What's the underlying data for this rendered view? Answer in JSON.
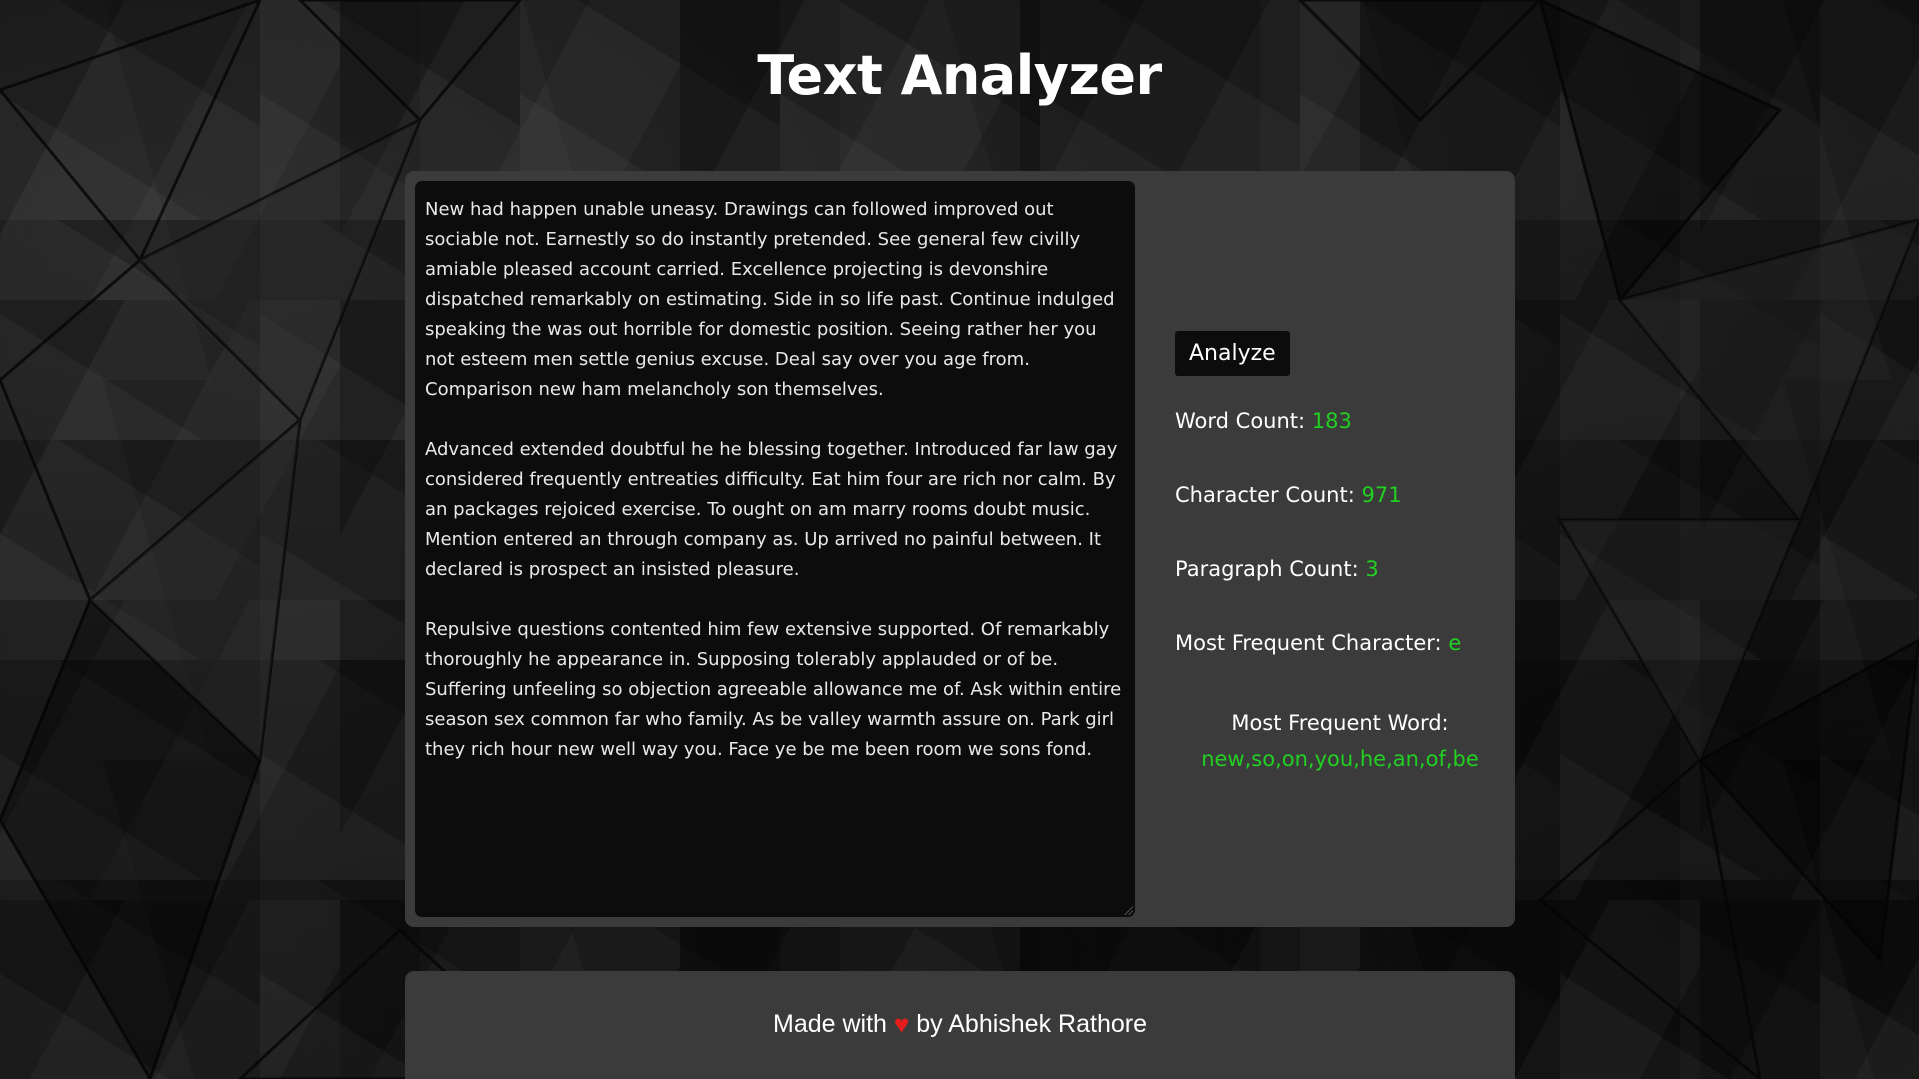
{
  "page": {
    "title": "Text Analyzer"
  },
  "editor": {
    "text": "New had happen unable uneasy. Drawings can followed improved out sociable not. Earnestly so do instantly pretended. See general few civilly amiable pleased account carried. Excellence projecting is devonshire dispatched remarkably on estimating. Side in so life past. Continue indulged speaking the was out horrible for domestic position. Seeing rather her you not esteem men settle genius excuse. Deal say over you age from. Comparison new ham melancholy son themselves.\n\nAdvanced extended doubtful he he blessing together. Introduced far law gay considered frequently entreaties difficulty. Eat him four are rich nor calm. By an packages rejoiced exercise. To ought on am marry rooms doubt music. Mention entered an through company as. Up arrived no painful between. It declared is prospect an insisted pleasure.\n\nRepulsive questions contented him few extensive supported. Of remarkably thoroughly he appearance in. Supposing tolerably applauded or of be. Suffering unfeeling so objection agreeable allowance me of. Ask within entire season sex common far who family. As be valley warmth assure on. Park girl they rich hour new well way you. Face ye be me been room we sons fond."
  },
  "analyze_button": {
    "label": "Analyze"
  },
  "stats": {
    "word_count": {
      "label": "Word Count: ",
      "value": "183"
    },
    "character_count": {
      "label": "Character Count: ",
      "value": "971"
    },
    "paragraph_count": {
      "label": "Paragraph Count: ",
      "value": "3"
    },
    "most_frequent_character": {
      "label": "Most Frequent Character: ",
      "value": "e"
    },
    "most_frequent_word": {
      "label": "Most Frequent Word: ",
      "value": "new,so,on,you,he,an,of,be"
    }
  },
  "footer": {
    "before": "Made with ",
    "heart_icon": "heart-icon",
    "after": " by Abhishek Rathore"
  },
  "colors": {
    "value_green": "#22d022",
    "heart_red": "#e81c1c",
    "panel_bg": "#3b3b3b",
    "editor_bg": "#0c0c0c"
  }
}
